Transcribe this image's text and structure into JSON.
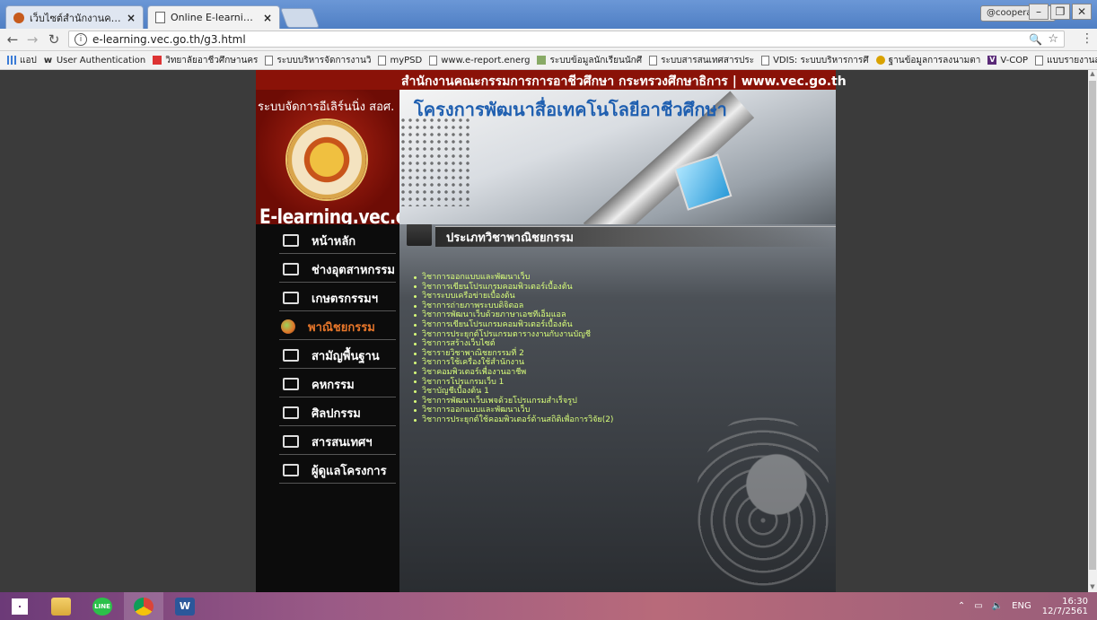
{
  "browser": {
    "tabs": [
      {
        "title": "เว็บไซต์สำนักงานคณะกรรมการ",
        "active": false
      },
      {
        "title": "Online E-learning Of VEC",
        "active": true
      }
    ],
    "profile_label": "@cooperation",
    "url": "e-learning.vec.go.th/g3.html",
    "zoom_icon": "zoom-icon",
    "bookmarks": [
      {
        "label": "แอป",
        "icon": "apps"
      },
      {
        "label": "User Authentication",
        "icon": "w"
      },
      {
        "label": "วิทยาลัยอาชีวศึกษานคร",
        "icon": "red"
      },
      {
        "label": "ระบบบริหารจัดการงานวิ",
        "icon": "doc"
      },
      {
        "label": "myPSD",
        "icon": "doc"
      },
      {
        "label": "www.e-report.energ",
        "icon": "doc"
      },
      {
        "label": "ระบบข้อมูลนักเรียนนักศึ",
        "icon": "img"
      },
      {
        "label": "ระบบสารสนเทศสารประ",
        "icon": "doc"
      },
      {
        "label": "VDIS: ระบบบริหารการศึ",
        "icon": "doc"
      },
      {
        "label": "ฐานข้อมูลการลงนามตา",
        "icon": "gold"
      },
      {
        "label": "V-COP",
        "icon": "v"
      },
      {
        "label": "แบบรายงานสรุปการปฏิ",
        "icon": "doc"
      }
    ],
    "more_bookmarks": "»"
  },
  "site": {
    "top_strip": "สำนักงานคณะกรรมการการอาชีวศึกษา กระทรวงศึกษาธิการ | www.vec.go.th",
    "system_name": "ระบบจัดการอีเลิร์นนิ่ง สอศ.",
    "domain": "E-learning.vec.go.th",
    "project_title": "โครงการพัฒนาสื่อเทคโนโลยีอาชีวศึกษา",
    "nav": [
      {
        "label": "หน้าหลัก",
        "active": false
      },
      {
        "label": "ช่างอุตสาหกรรม",
        "active": false
      },
      {
        "label": "เกษตรกรรมฯ",
        "active": false
      },
      {
        "label": "พาณิชยกรรม",
        "active": true
      },
      {
        "label": "สามัญพื้นฐาน",
        "active": false
      },
      {
        "label": "คหกรรม",
        "active": false
      },
      {
        "label": "ศิลปกรรม",
        "active": false
      },
      {
        "label": "สารสนเทศฯ",
        "active": false
      },
      {
        "label": "ผู้ดูแลโครงการ",
        "active": false
      }
    ],
    "section_title": "ประเภทวิชาพาณิชยกรรม",
    "courses": [
      "วิชาการออกแบบและพัฒนาเว็บ",
      "วิชาการเขียนโปรแกรมคอมพิวเตอร์เบื้องต้น",
      "วิชาระบบเครือข่ายเบื้องต้น",
      "วิชาการถ่ายภาพระบบดิจิตอล",
      "วิชาการพัฒนาเว็บด้วยภาษาเอชทีเอ็มแอล",
      "วิชาการเขียนโปรแกรมคอมพิวเตอร์เบื้องต้น",
      "วิชาการประยุกต์โปรแกรมตารางงานกับงานบัญชี",
      "วิชาการสร้างเว็บไซต์",
      "วิชารายวิชาพาณิชยกรรมที่ 2",
      "วิชาการใช้เครื่องใช้สำนักงาน",
      "วิชาคอมพิวเตอร์เพื่องานอาชีพ",
      "วิชาการโปรแกรมเว็บ 1",
      "วิชาบัญชีเบื้องต้น 1",
      "วิชาการพัฒนาเว็บเพจด้วยโปรแกรมสำเร็จรูป",
      "วิชาการออกแบบและพัฒนาเว็บ",
      "วิชาการประยุกต์ใช้คอมพิวเตอร์ด้านสถิติเพื่อการวิจัย(2)"
    ],
    "colors": {
      "red": "#8a1208",
      "active_nav": "#e7762a",
      "course_text": "#d9ff7a"
    }
  },
  "taskbar": {
    "apps": [
      "start-icon",
      "file-explorer-icon",
      "line-icon",
      "chrome-icon",
      "word-icon"
    ],
    "tray": {
      "language": "ENG",
      "time": "16:30",
      "date": "12/7/2561"
    }
  }
}
